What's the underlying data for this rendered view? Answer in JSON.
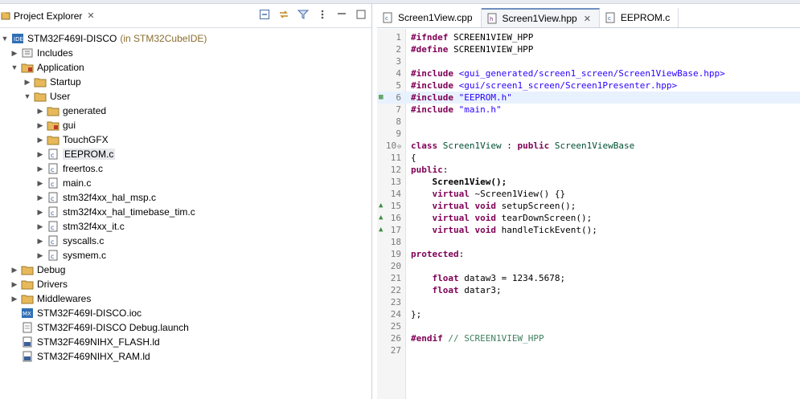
{
  "explorer": {
    "tab_title": "Project Explorer",
    "project_name": "STM32F469I-DISCO",
    "project_suffix": "(in STM32CubeIDE)",
    "items": [
      {
        "label": "Includes",
        "icon": "includes-icon"
      },
      {
        "label": "Application",
        "icon": "folder-src-icon"
      },
      {
        "label": "Startup",
        "icon": "folder-icon"
      },
      {
        "label": "User",
        "icon": "folder-icon"
      },
      {
        "label": "generated",
        "icon": "folder-icon"
      },
      {
        "label": "gui",
        "icon": "folder-src-icon"
      },
      {
        "label": "TouchGFX",
        "icon": "folder-icon"
      },
      {
        "label": "EEPROM.c",
        "icon": "c-file-icon"
      },
      {
        "label": "freertos.c",
        "icon": "c-file-icon"
      },
      {
        "label": "main.c",
        "icon": "c-file-icon"
      },
      {
        "label": "stm32f4xx_hal_msp.c",
        "icon": "c-file-icon"
      },
      {
        "label": "stm32f4xx_hal_timebase_tim.c",
        "icon": "c-file-icon"
      },
      {
        "label": "stm32f4xx_it.c",
        "icon": "c-file-icon"
      },
      {
        "label": "syscalls.c",
        "icon": "c-file-icon"
      },
      {
        "label": "sysmem.c",
        "icon": "c-file-icon"
      },
      {
        "label": "Debug",
        "icon": "folder-icon"
      },
      {
        "label": "Drivers",
        "icon": "folder-icon"
      },
      {
        "label": "Middlewares",
        "icon": "folder-icon"
      },
      {
        "label": "STM32F469I-DISCO.ioc",
        "icon": "ioc-file-icon"
      },
      {
        "label": "STM32F469I-DISCO Debug.launch",
        "icon": "launch-file-icon"
      },
      {
        "label": "STM32F469NIHX_FLASH.ld",
        "icon": "ld-file-icon"
      },
      {
        "label": "STM32F469NIHX_RAM.ld",
        "icon": "ld-file-icon"
      }
    ]
  },
  "editor": {
    "tabs": [
      {
        "label": "Screen1View.cpp",
        "icon": "cpp-file-icon"
      },
      {
        "label": "Screen1View.hpp",
        "icon": "hpp-file-icon"
      },
      {
        "label": "EEPROM.c",
        "icon": "c-file-icon"
      }
    ],
    "line_numbers": [
      "1",
      "2",
      "3",
      "4",
      "5",
      "6",
      "7",
      "8",
      "9",
      "10",
      "11",
      "12",
      "13",
      "14",
      "15",
      "16",
      "17",
      "18",
      "19",
      "20",
      "21",
      "22",
      "23",
      "24",
      "25",
      "26",
      "27"
    ],
    "code": {
      "l1a": "#ifndef",
      "l1b": " SCREEN1VIEW_HPP",
      "l2a": "#define",
      "l2b": " SCREEN1VIEW_HPP",
      "l4a": "#include",
      "l4b": " <gui_generated/screen1_screen/Screen1ViewBase.hpp>",
      "l5a": "#include",
      "l5b": " <gui/screen1_screen/Screen1Presenter.hpp>",
      "l6a": "#include",
      "l6b": " \"EEPROM.h\"",
      "l7a": "#include",
      "l7b": " \"main.h\"",
      "l10a": "class",
      "l10b": " Screen1View",
      "l10c": " : ",
      "l10d": "public",
      "l10e": " Screen1ViewBase",
      "l11": "{",
      "l12a": "public",
      "l12b": ":",
      "l13": "    Screen1View();",
      "l14a": "    virtual",
      "l14b": " ~Screen1View() {}",
      "l15a": "    virtual",
      "l15b": " void",
      "l15c": " setupScreen();",
      "l16a": "    virtual",
      "l16b": " void",
      "l16c": " tearDownScreen();",
      "l17a": "    virtual",
      "l17b": " void",
      "l17c": " handleTickEvent();",
      "l19a": "protected",
      "l19b": ":",
      "l21a": "    float",
      "l21b": " dataw3 = 1234.5678;",
      "l22a": "    float",
      "l22b": " datar3;",
      "l24": "};",
      "l26a": "#endif",
      "l26b": " // SCREEN1VIEW_HPP"
    }
  },
  "colors": {
    "keyword": "#7f0055",
    "string": "#2a00ff",
    "comment": "#3f7f5f"
  }
}
